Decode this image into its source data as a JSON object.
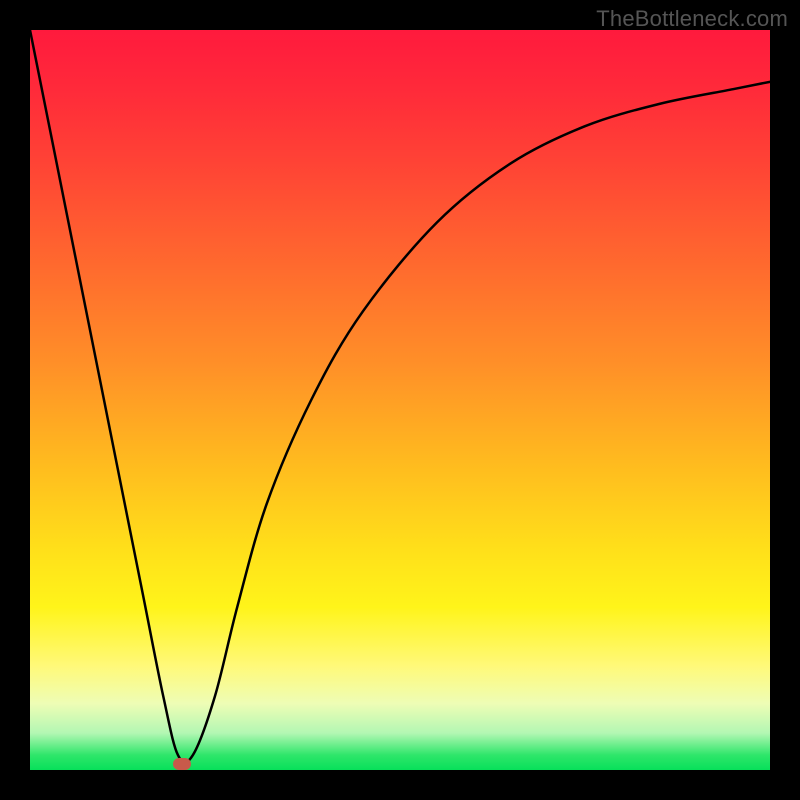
{
  "watermark": "TheBottleneck.com",
  "chart_data": {
    "type": "line",
    "title": "",
    "xlabel": "",
    "ylabel": "",
    "xlim": [
      0,
      100
    ],
    "ylim": [
      0,
      100
    ],
    "grid": false,
    "legend": false,
    "background_gradient": {
      "top_color": "#ff1a3d",
      "mid_color": "#ffe01a",
      "bottom_color": "#07e05a"
    },
    "curve_description": "V-shaped curve that drops steeply from top-left to a minimum near x≈20 at y≈0, then rises along a saturating curve toward the upper right",
    "series": [
      {
        "name": "bottleneck-curve",
        "x": [
          0,
          5,
          10,
          15,
          18,
          20,
          22,
          25,
          28,
          32,
          38,
          45,
          55,
          65,
          75,
          85,
          95,
          100
        ],
        "values": [
          100,
          75,
          50,
          25,
          10,
          2,
          2,
          10,
          22,
          36,
          50,
          62,
          74,
          82,
          87,
          90,
          92,
          93
        ]
      }
    ],
    "marker": {
      "x": 20.5,
      "y": 0.8,
      "color": "#c85a4a",
      "shape": "pill"
    }
  }
}
